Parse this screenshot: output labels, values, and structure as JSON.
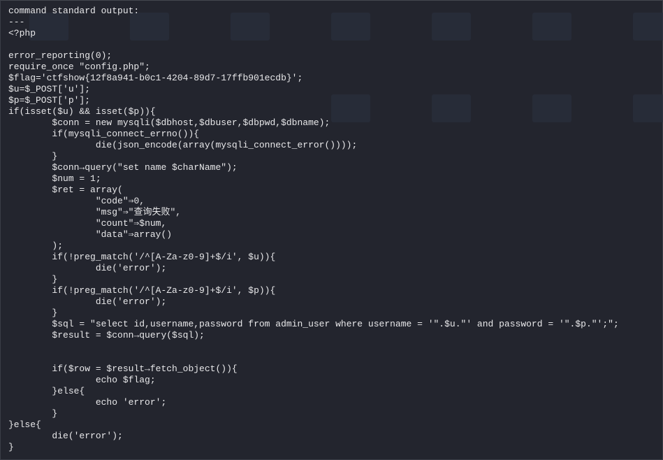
{
  "terminal": {
    "lines": [
      "command standard output:",
      "---",
      "<?php",
      "",
      "error_reporting(0);",
      "require_once \"config.php\";",
      "$flag='ctfshow{12f8a941-b0c1-4204-89d7-17ffb901ecdb}';",
      "$u=$_POST['u'];",
      "$p=$_POST['p'];",
      "if(isset($u) && isset($p)){",
      "\t$conn = new mysqli($dbhost,$dbuser,$dbpwd,$dbname);",
      "\tif(mysqli_connect_errno()){",
      "\t\tdie(json_encode(array(mysqli_connect_error())));",
      "\t}",
      "\t$conn→query(\"set name $charName\");",
      "\t$num = 1;",
      "\t$ret = array(",
      "\t\t\"code\"⇒0,",
      "\t\t\"msg\"⇒\"查询失败\",",
      "\t\t\"count\"⇒$num,",
      "\t\t\"data\"⇒array()",
      "\t);",
      "\tif(!preg_match('/^[A-Za-z0-9]+$/i', $u)){",
      "\t\tdie('error');",
      "\t}",
      "\tif(!preg_match('/^[A-Za-z0-9]+$/i', $p)){",
      "\t\tdie('error');",
      "\t}",
      "\t$sql = \"select id,username,password from admin_user where username = '\".$u.\"' and password = '\".$p.\"';\";",
      "\t$result = $conn→query($sql);",
      "",
      "",
      "\tif($row = $result→fetch_object()){",
      "\t\techo $flag;",
      "\t}else{",
      "\t\techo 'error';",
      "\t}",
      "}else{",
      "\tdie('error');",
      "}"
    ]
  },
  "colors": {
    "background": "#23252e",
    "text": "#e8e8ea"
  }
}
